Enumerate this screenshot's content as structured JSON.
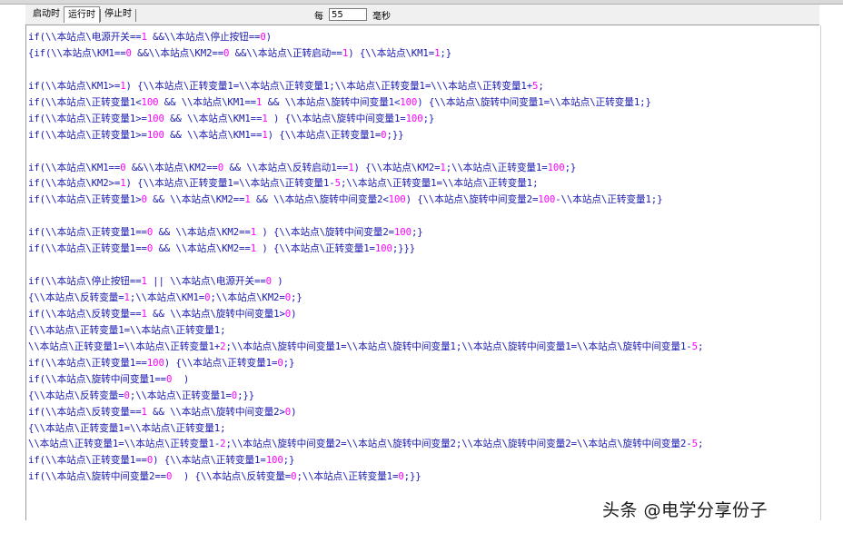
{
  "tabs": [
    "启动时",
    "运行时",
    "停止时"
  ],
  "active_tab": "运行时",
  "period": {
    "label_prefix": "每",
    "value": "55",
    "unit": "毫秒"
  },
  "code_lines": [
    "if(\\\\本站点\\电源开关==1 &&\\\\本站点\\停止按钮==0)",
    "{if(\\\\本站点\\KM1==0 &&\\\\本站点\\KM2==0 &&\\\\本站点\\正转启动==1) {\\\\本站点\\KM1=1;}",
    "",
    "if(\\\\本站点\\KM1>=1) {\\\\本站点\\正转变量1=\\\\本站点\\正转变量1;\\\\本站点\\正转变量1=\\\\\\本站点\\正转变量1+5;",
    "if(\\\\本站点\\正转变量1<100 && \\\\本站点\\KM1==1 && \\\\本站点\\旋转中间变量1<100) {\\\\本站点\\旋转中间变量1=\\\\本站点\\正转变量1;}",
    "if(\\\\本站点\\正转变量1>=100 && \\\\本站点\\KM1==1 ) {\\\\本站点\\旋转中间变量1=100;}",
    "if(\\\\本站点\\正转变量1>=100 && \\\\本站点\\KM1==1) {\\\\本站点\\正转变量1=0;}}",
    "",
    "if(\\\\本站点\\KM1==0 &&\\\\本站点\\KM2==0 && \\\\本站点\\反转启动1==1) {\\\\本站点\\KM2=1;\\\\本站点\\正转变量1=100;}",
    "if(\\\\本站点\\KM2>=1) {\\\\本站点\\正转变量1=\\\\本站点\\正转变量1-5;\\\\本站点\\正转变量1=\\\\本站点\\正转变量1;",
    "if(\\\\本站点\\正转变量1>0 && \\\\本站点\\KM2==1 && \\\\本站点\\旋转中间变量2<100) {\\\\本站点\\旋转中间变量2=100-\\\\本站点\\正转变量1;}",
    "",
    "if(\\\\本站点\\正转变量1==0 && \\\\本站点\\KM2==1 ) {\\\\本站点\\旋转中间变量2=100;}",
    "if(\\\\本站点\\正转变量1==0 && \\\\本站点\\KM2==1 ) {\\\\本站点\\正转变量1=100;}}}",
    "",
    "if(\\\\本站点\\停止按钮==1 || \\\\本站点\\电源开关==0 )",
    "{\\\\本站点\\反转变量=1;\\\\本站点\\KM1=0;\\\\本站点\\KM2=0;}",
    "if(\\\\本站点\\反转变量==1 && \\\\本站点\\旋转中间变量1>0)",
    "{\\\\本站点\\正转变量1=\\\\本站点\\正转变量1;",
    "\\\\本站点\\正转变量1=\\\\本站点\\正转变量1+2;\\\\本站点\\旋转中间变量1=\\\\本站点\\旋转中间变量1;\\\\本站点\\旋转中间变量1=\\\\本站点\\旋转中间变量1-5;",
    "if(\\\\本站点\\正转变量1==100) {\\\\本站点\\正转变量1=0;}",
    "if(\\\\本站点\\旋转中间变量1==0  )",
    "{\\\\本站点\\反转变量=0;\\\\本站点\\正转变量1=0;}}",
    "if(\\\\本站点\\反转变量==1 && \\\\本站点\\旋转中间变量2>0)",
    "{\\\\本站点\\正转变量1=\\\\本站点\\正转变量1;",
    "\\\\本站点\\正转变量1=\\\\本站点\\正转变量1-2;\\\\本站点\\旋转中间变量2=\\\\本站点\\旋转中间变量2;\\\\本站点\\旋转中间变量2=\\\\本站点\\旋转中间变量2-5;",
    "if(\\\\本站点\\正转变量1==0) {\\\\本站点\\正转变量1=100;}",
    "if(\\\\本站点\\旋转中间变量2==0  ) {\\\\本站点\\反转变量=0;\\\\本站点\\正转变量1=0;}}"
  ],
  "watermark": "头条 @电学分享份子",
  "colors": {
    "code_text": "#1a1ab0",
    "numeric_literal": "#ff00ff",
    "tab_bar": "#f0f0f0"
  }
}
